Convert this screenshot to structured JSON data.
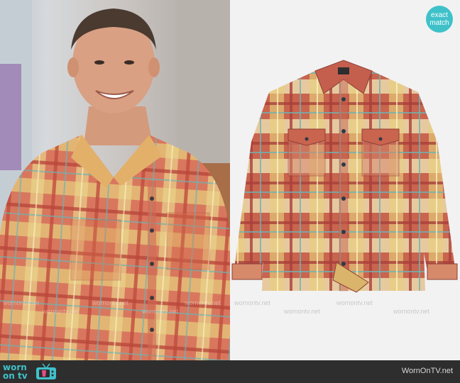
{
  "badge": {
    "line1": "exact",
    "line2": "match"
  },
  "footer": {
    "logo_line1": "worn",
    "logo_line2": "on tv",
    "site": "WornOnTV.net"
  },
  "watermark": {
    "text": "wornontv.net"
  },
  "colors": {
    "accent": "#3fc1c9",
    "footer_bg": "#2e2e2e",
    "plaid_red": "#c9644f",
    "plaid_yellow": "#e7d07a",
    "plaid_cream": "#efe2b4",
    "plaid_teal": "#6fb3b0"
  },
  "icons": {
    "tv": "tv-icon"
  }
}
